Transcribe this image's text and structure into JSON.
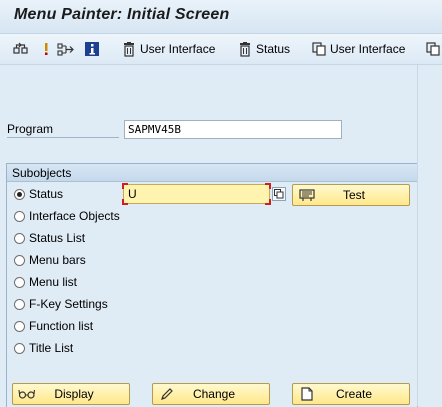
{
  "window": {
    "title": "Menu Painter: Initial Screen"
  },
  "toolbar": {
    "items": [
      {
        "icon": "other-object-icon",
        "label": ""
      },
      {
        "icon": "info-exclamation-icon",
        "label": ""
      },
      {
        "icon": "where-used-icon",
        "label": ""
      },
      {
        "icon": "information-icon",
        "label": ""
      },
      {
        "icon": "delete-icon",
        "label": "User Interface"
      },
      {
        "icon": "delete-icon",
        "label": "Status"
      },
      {
        "icon": "copy-icon",
        "label": "User Interface"
      },
      {
        "icon": "copy-icon",
        "label": ""
      }
    ]
  },
  "program": {
    "label": "Program",
    "value": "SAPMV45B"
  },
  "subobjects": {
    "title": "Subobjects",
    "selected": "Status",
    "options": [
      "Status",
      "Interface Objects",
      "Status List",
      "Menu bars",
      "Menu list",
      "F-Key Settings",
      "Function list",
      "Title List"
    ],
    "status_input": {
      "value": "U"
    }
  },
  "buttons": {
    "test": {
      "label": "Test",
      "icon": "test-icon"
    },
    "display": {
      "label": "Display",
      "icon": "display-glasses-icon"
    },
    "change": {
      "label": "Change",
      "icon": "pencil-icon"
    },
    "create": {
      "label": "Create",
      "icon": "new-document-icon"
    }
  },
  "colors": {
    "background": "#dfebf5",
    "button_fill": "#ffe88a",
    "input_highlight": "#fff3b0",
    "focus_corner": "#cc1f1f"
  }
}
